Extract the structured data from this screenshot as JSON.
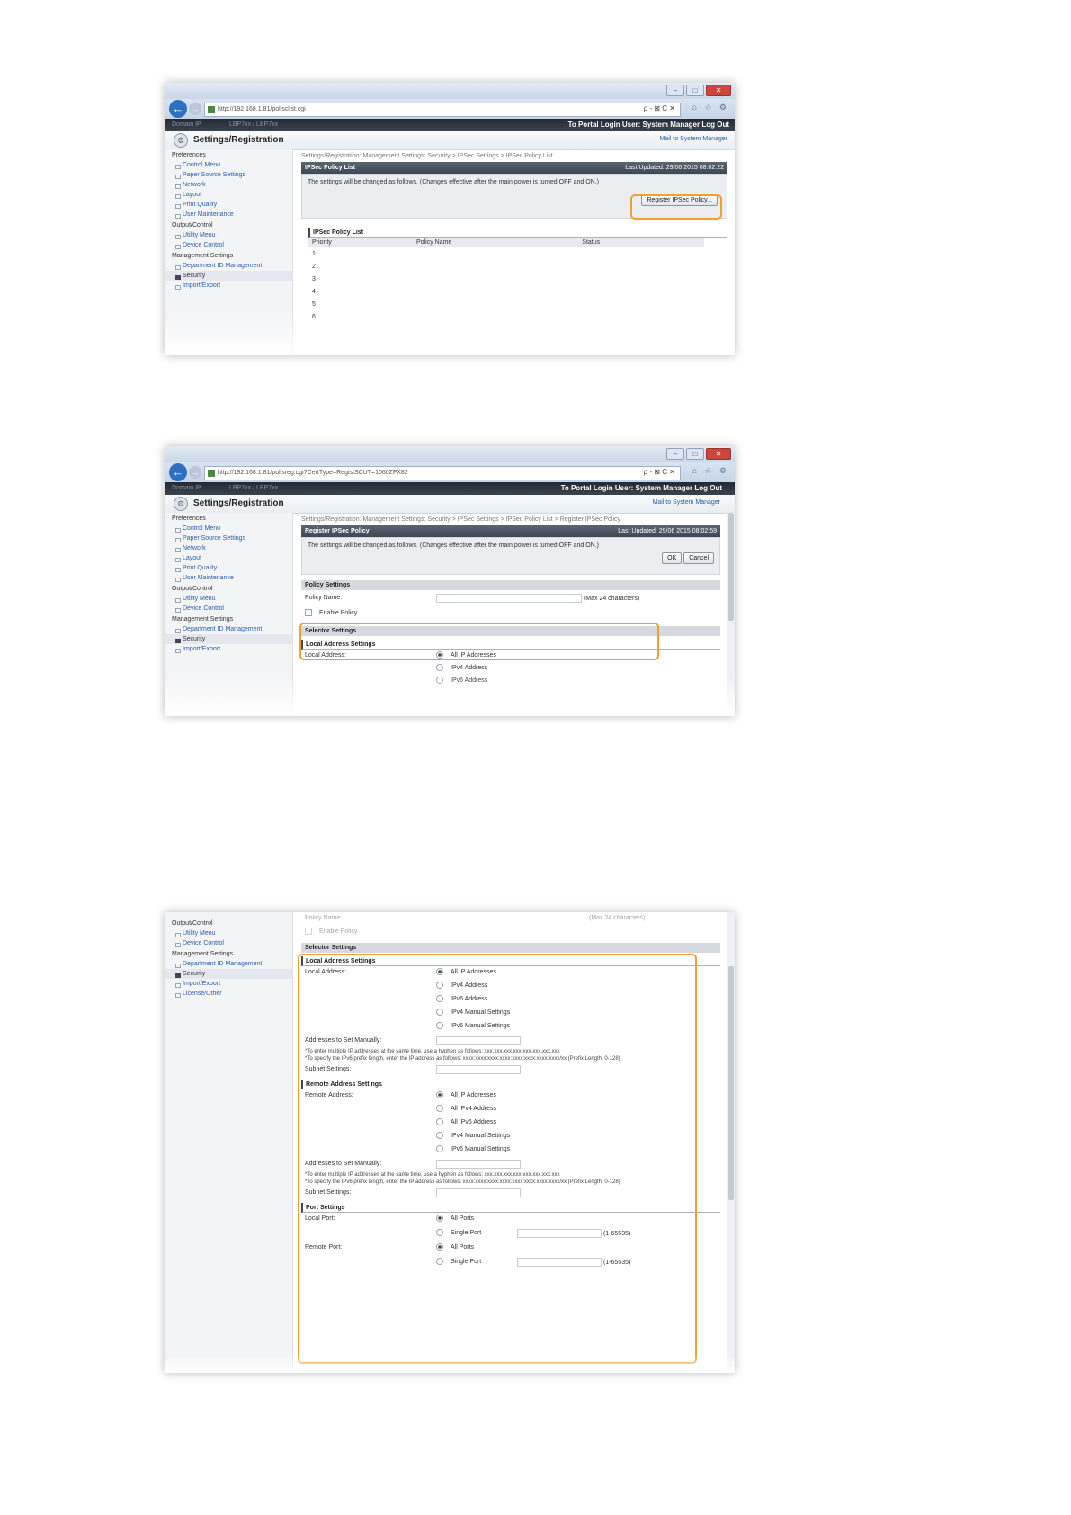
{
  "browser": {
    "url1": "http://192.168.1.81/polisclist.cgi",
    "url2": "http://192.168.1.81/polisreg.cgi?CertType=RegistSCUT=1060ZFX82",
    "addr_controls": "ρ - ⊠ C ✕",
    "toolbar_icons": "⌂ ☆ ⚙"
  },
  "topbar": {
    "left_text": "Domain IP",
    "mid_text": "LBP7xx / LBP7xx",
    "links": "To Portal  Login User: System Manager Log Out"
  },
  "header": {
    "title": "Settings/Registration",
    "mail_link": "Mail to System Manager"
  },
  "sidebar": {
    "preferences": "Preferences",
    "pref_items": [
      "Control Menu",
      "Paper Source Settings",
      "Network",
      "Layout",
      "Print Quality",
      "User Maintenance"
    ],
    "output_control": "Output/Control",
    "output_items": [
      "Utility Menu",
      "Device Control"
    ],
    "management": "Management Settings",
    "mgmt_items": [
      "Department ID Management",
      "Security",
      "Import/Export",
      "License/Other"
    ]
  },
  "screen1": {
    "breadcrumb": "Settings/Registration: Management Settings: Security > IPSec Settings > IPSec Policy List",
    "panel_title": "IPSec Policy List",
    "last_updated": "Last Updated: 29/06 2015 08:02:22",
    "message": "The settings will be changed as follows. (Changes effective after the main power is turned OFF and ON.)",
    "register_button": "Register IPSec Policy...",
    "list_title": "IPSec Policy List",
    "columns": [
      "Priority",
      "Policy Name",
      "Status"
    ],
    "rows": [
      "1",
      "2",
      "3",
      "4",
      "5",
      "6"
    ]
  },
  "screen2": {
    "breadcrumb": "Settings/Registration: Management Settings: Security > IPSec Settings > IPSec Policy List > Register IPSec Policy",
    "panel_title": "Register IPSec Policy",
    "last_updated": "Last Updated: 29/06 2015 08:02:59",
    "message": "The settings will be changed as follows. (Changes effective after the main power is turned OFF and ON.)",
    "ok_button": "OK",
    "cancel_button": "Cancel",
    "policy_settings": "Policy Settings",
    "policy_name_label": "Policy Name:",
    "policy_name_hint": "(Max 24 characters)",
    "enable_policy": "Enable Policy",
    "selector_settings": "Selector Settings",
    "local_address_settings": "Local Address Settings",
    "local_address_label": "Local Address:",
    "local_options": [
      "All IP Addresses",
      "IPv4 Address",
      "IPv6 Address"
    ]
  },
  "screen3": {
    "policy_name_label": "Policy Name:",
    "policy_name_hint": "(Max 24 characters)",
    "enable_policy": "Enable Policy",
    "selector_settings": "Selector Settings",
    "local_address_settings": "Local Address Settings",
    "local_address_label": "Local Address:",
    "local_options": [
      "All IP Addresses",
      "IPv4 Address",
      "IPv6 Address",
      "IPv4 Manual Settings",
      "IPv6 Manual Settings"
    ],
    "manual_label": "Addresses to Set Manually:",
    "note1": "*To enter multiple IP addresses at the same time, use a hyphen as follows: xxx.xxx.xxx.xxx-xxx.xxx.xxx.xxx",
    "note2": "*To specify the IPv6 prefix length, enter the IP address as follows: xxxx:xxxx:xxxx:xxxx:xxxx:xxxx:xxxx:xxxx/xx (Prefix Length: 0-128)",
    "subnet_label": "Subnet Settings:",
    "remote_address_settings": "Remote Address Settings",
    "remote_address_label": "Remote Address:",
    "remote_options": [
      "All IP Addresses",
      "All IPv4 Address",
      "All IPv6 Address",
      "IPv4 Manual Settings",
      "IPv6 Manual Settings"
    ],
    "port_settings": "Port Settings",
    "local_port_label": "Local Port:",
    "remote_port_label": "Remote Port:",
    "port_options": [
      "All Ports",
      "Single Port"
    ],
    "port_range": "(1-65535)"
  },
  "colors": {
    "highlight": "#f0a030",
    "link": "#2b5ea8",
    "panel_header": "#4a545f"
  }
}
